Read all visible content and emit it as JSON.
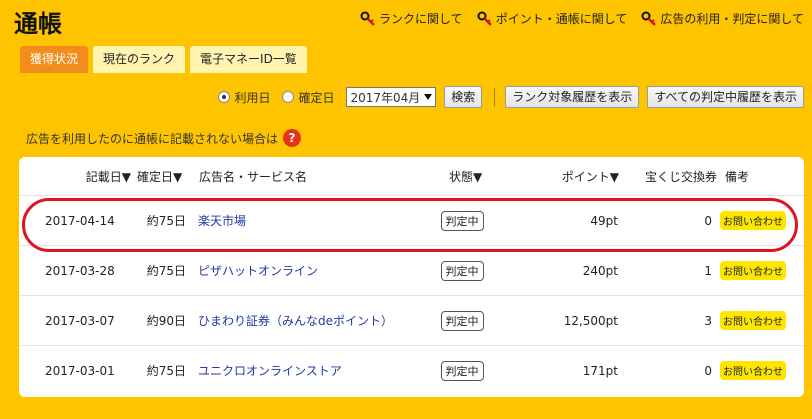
{
  "header": {
    "title": "通帳",
    "help_links": [
      {
        "label": "ランクに関して",
        "icon": "key-icon"
      },
      {
        "label": "ポイント・通帳に関して",
        "icon": "key-icon"
      },
      {
        "label": "広告の利用・判定に関して",
        "icon": "key-icon"
      }
    ]
  },
  "tabs": [
    {
      "label": "獲得状況",
      "active": true
    },
    {
      "label": "現在のランク",
      "active": false
    },
    {
      "label": "電子マネーID一覧",
      "active": false
    }
  ],
  "filters": {
    "radio_record_date": "利用日",
    "radio_confirm_date": "確定日",
    "selected_radio": "利用日",
    "month_value": "2017年04月",
    "search_label": "検索",
    "rank_history_label": "ランク対象履歴を表示",
    "all_pending_label": "すべての判定中履歴を表示"
  },
  "notice": {
    "text": "広告を利用したのに通帳に記載されない場合は",
    "icon": "question-icon",
    "icon_glyph": "?"
  },
  "table": {
    "headers": {
      "record_date": "記載日▼",
      "confirm_date": "確定日▼",
      "name": "広告名・サービス名",
      "status": "状態▼",
      "points": "ポイント▼",
      "lottery": "宝くじ交換券",
      "note": "備考"
    },
    "rows": [
      {
        "record_date": "2017-04-14",
        "confirm_date": "約75日",
        "name": "楽天市場",
        "status": "判定中",
        "points": "49pt",
        "lottery": "0",
        "note": "お問い合わせ"
      },
      {
        "record_date": "2017-03-28",
        "confirm_date": "約75日",
        "name": "ピザハットオンライン",
        "status": "判定中",
        "points": "240pt",
        "lottery": "1",
        "note": "お問い合わせ"
      },
      {
        "record_date": "2017-03-07",
        "confirm_date": "約90日",
        "name": "ひまわり証券（みんなdeポイント）",
        "status": "判定中",
        "points": "12,500pt",
        "lottery": "3",
        "note": "お問い合わせ"
      },
      {
        "record_date": "2017-03-01",
        "confirm_date": "約75日",
        "name": "ユニクロオンラインストア",
        "status": "判定中",
        "points": "171pt",
        "lottery": "0",
        "note": "お問い合わせ"
      }
    ]
  },
  "colors": {
    "background": "#FFC400",
    "active_tab": "#F28C1C",
    "link": "#2238A3",
    "highlight": "#E0141E",
    "inquiry": "#FFE600"
  }
}
